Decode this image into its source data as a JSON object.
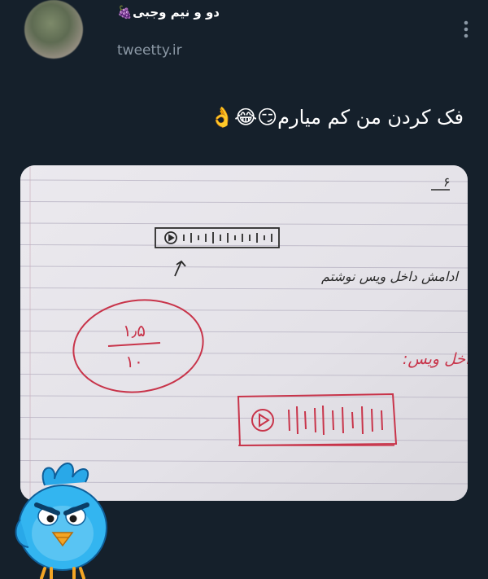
{
  "header": {
    "display_name": "دو و نیم وجبی🍇",
    "handle": "tweetty.ir",
    "avatar_icon": "blurred-profile-photo",
    "more_icon": "vertical-ellipsis-icon"
  },
  "tweet": {
    "text": "فک کردن من کم میارم😏😂👌"
  },
  "media": {
    "page_number": "۶",
    "handwriting_line1": "ادامش داخل ویس نوشتم",
    "score_numerator": "۱٫۵",
    "score_denominator": "۱۰",
    "handwriting_line2": "بقیه نمرات داخل ویس:"
  },
  "colors": {
    "background": "#15202b",
    "text_primary": "#ffffff",
    "text_secondary": "#8b98a5",
    "ink_dark": "#2b2b2b",
    "ink_red": "#c8344a"
  },
  "sticker": {
    "icon": "angry-blue-bird-sticker"
  }
}
